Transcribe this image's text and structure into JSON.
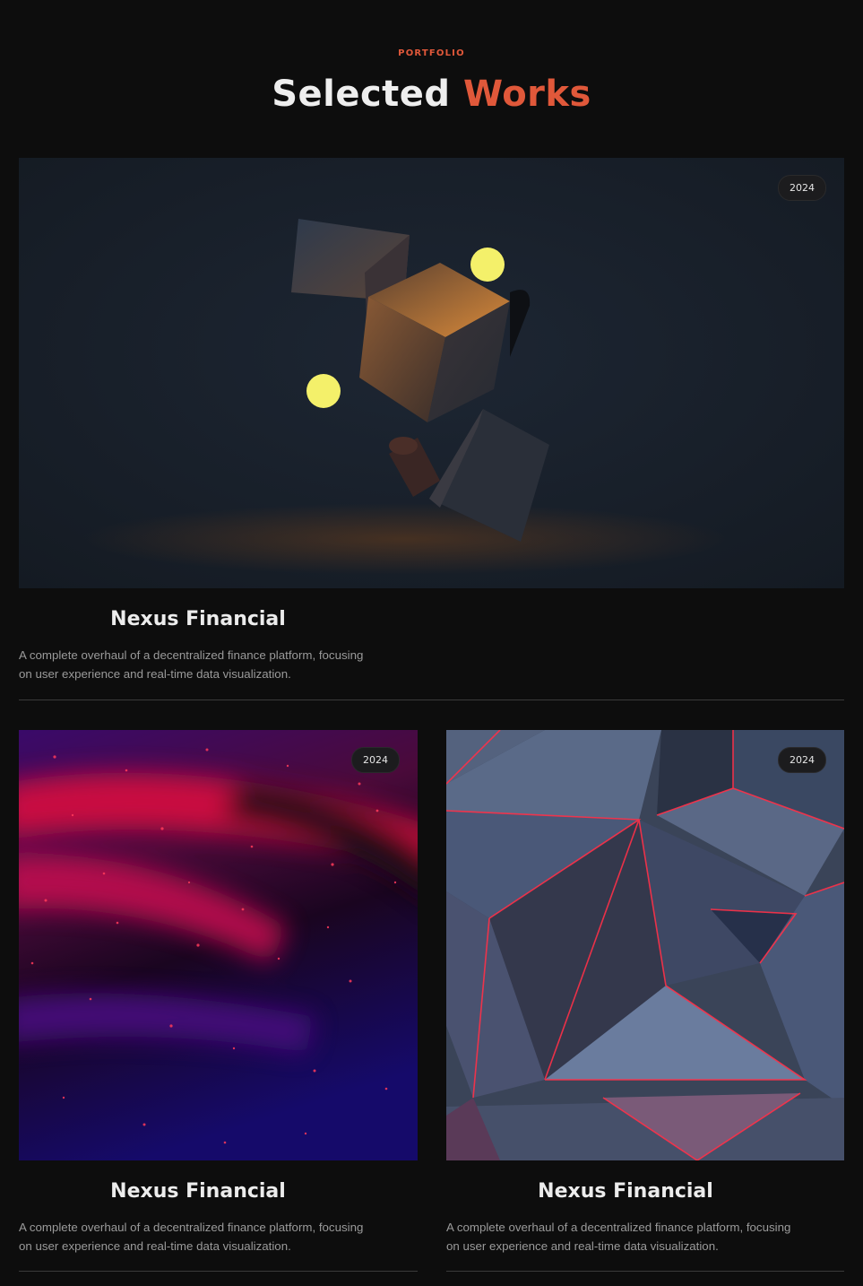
{
  "header": {
    "eyebrow": "PORTFOLIO",
    "title_main": "Selected",
    "title_accent": "Works"
  },
  "colors": {
    "accent": "#e0583a",
    "background": "#0d0d0d"
  },
  "projects": [
    {
      "year": "2024",
      "title": "Nexus Financial",
      "description_line1": "A complete overhaul of a decentralized finance platform, focusing",
      "description_line2": "on user experience and real-time data visualization.",
      "image": "floating-cubes-image"
    },
    {
      "year": "2024",
      "title": "Nexus Financial",
      "description_line1": "A complete overhaul of a decentralized finance platform, focusing",
      "description_line2": "on user experience and real-time data visualization.",
      "image": "red-particles-image"
    },
    {
      "year": "2024",
      "title": "Nexus Financial",
      "description_line1": "A complete overhaul of a decentralized finance platform, focusing",
      "description_line2": "on user experience and real-time data visualization.",
      "image": "neon-pyramids-image"
    }
  ]
}
